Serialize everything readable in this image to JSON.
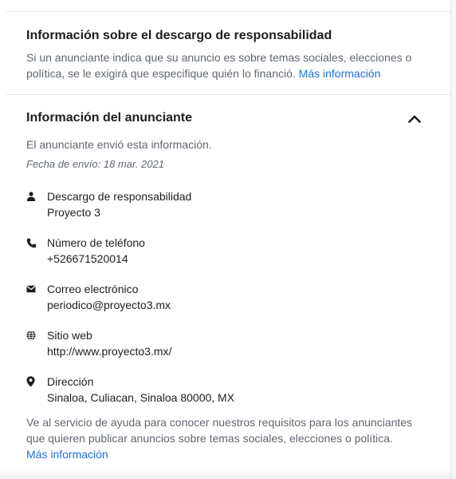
{
  "disclaimer": {
    "title": "Información sobre el descargo de responsabilidad",
    "text": "Si un anunciante indica que su anuncio es sobre temas sociales, elecciones o política, se le exigirá que especifique quién lo financió.",
    "link": "Más información"
  },
  "advertiser": {
    "title": "Información del anunciante",
    "toggle_icon": "chevron-up-icon",
    "subtitle": "El anunciante envió esta información.",
    "date": "Fecha de envío: 18 mar. 2021",
    "items": [
      {
        "icon": "person-icon",
        "label": "Descargo de responsabilidad",
        "value": "Proyecto 3"
      },
      {
        "icon": "phone-icon",
        "label": "Número de teléfono",
        "value": "+526671520014"
      },
      {
        "icon": "envelope-icon",
        "label": "Correo electrónico",
        "value": "periodico@proyecto3.mx"
      },
      {
        "icon": "globe-icon",
        "label": "Sitio web",
        "value": "http://www.proyecto3.mx/"
      },
      {
        "icon": "location-pin-icon",
        "label": "Dirección",
        "value": "Sinaloa, Culiacan, Sinaloa 80000, MX"
      }
    ]
  },
  "footer": {
    "text": "Ve al servicio de ayuda para conocer nuestros requisitos para los anunciantes que quieren publicar anuncios sobre temas sociales, elecciones o política.",
    "link": "Más información"
  },
  "colors": {
    "link": "#216fdb",
    "text": "#1c1e21",
    "secondary": "#606770"
  }
}
